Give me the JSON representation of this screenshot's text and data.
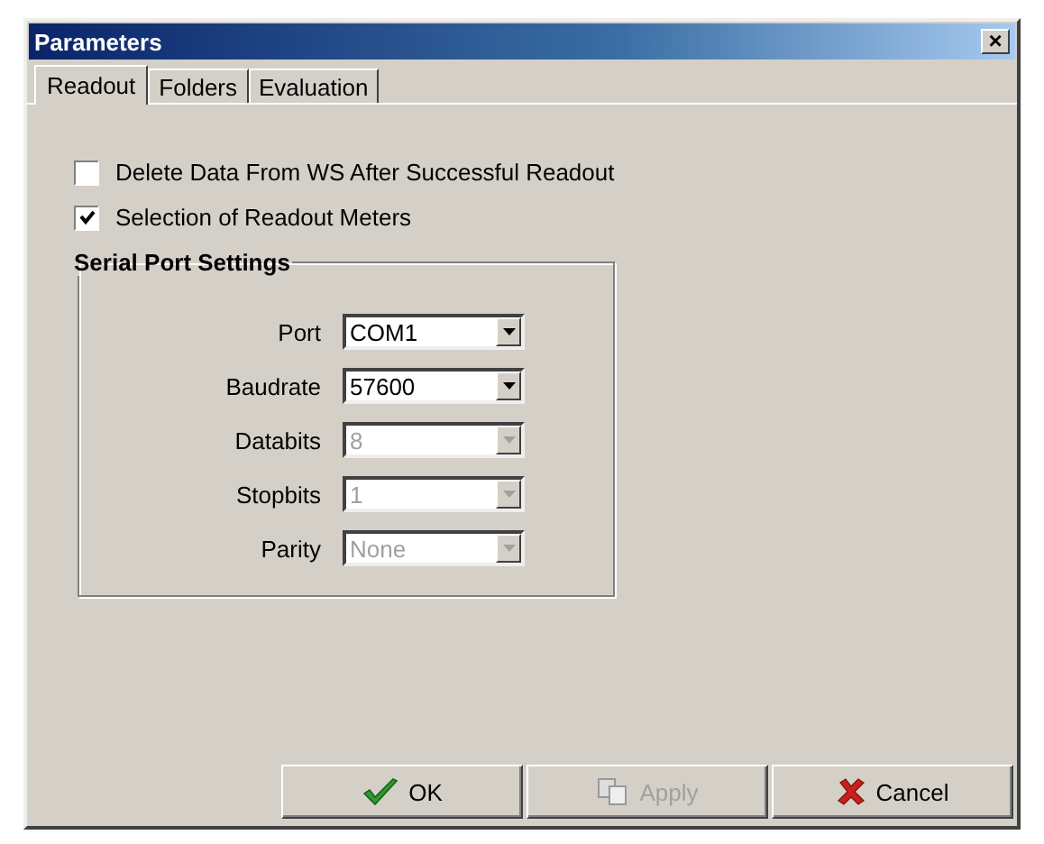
{
  "window": {
    "title": "Parameters",
    "close": "×"
  },
  "tabs": [
    {
      "label": "Readout",
      "selected": true
    },
    {
      "label": "Folders",
      "selected": false
    },
    {
      "label": "Evaluation",
      "selected": false
    }
  ],
  "options": [
    {
      "label": "Delete Data From WS After Successful Readout",
      "checked": false
    },
    {
      "label": "Selection of Readout Meters",
      "checked": true
    }
  ],
  "serial_port": {
    "title": "Serial Port Settings",
    "fields": [
      {
        "label": "Port",
        "value": "COM1",
        "disabled": false
      },
      {
        "label": "Baudrate",
        "value": "57600",
        "disabled": false
      },
      {
        "label": "Databits",
        "value": "8",
        "disabled": true
      },
      {
        "label": "Stopbits",
        "value": "1",
        "disabled": true
      },
      {
        "label": "Parity",
        "value": "None",
        "disabled": true
      }
    ]
  },
  "buttons": [
    {
      "kind": "ok",
      "label": "OK",
      "disabled": false
    },
    {
      "kind": "apply",
      "label": "Apply",
      "disabled": true
    },
    {
      "kind": "cancel",
      "label": "Cancel",
      "disabled": false
    }
  ]
}
